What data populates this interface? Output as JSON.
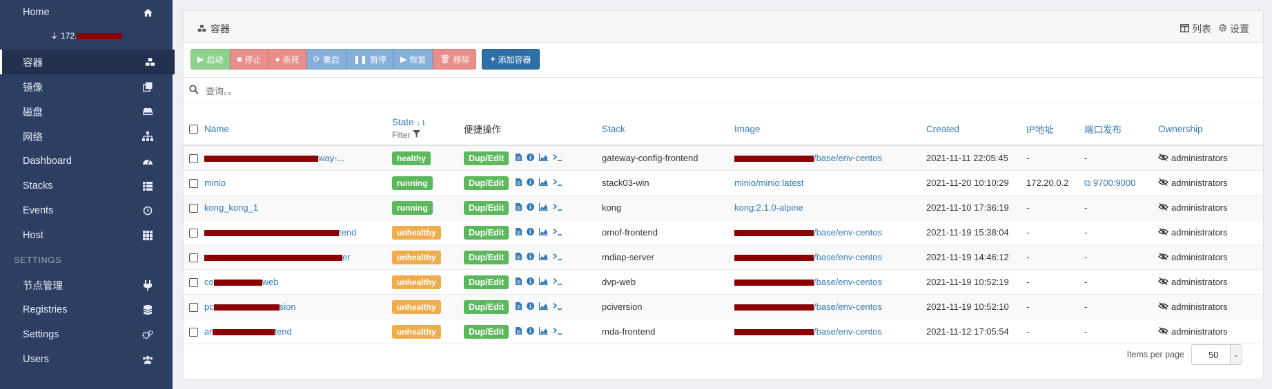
{
  "sidebar": {
    "items": [
      {
        "label": "Home",
        "icon": "home-icon"
      },
      {
        "label": "容器",
        "icon": "cubes-icon",
        "active": true
      },
      {
        "label": "镜像",
        "icon": "clone-icon"
      },
      {
        "label": "磁盘",
        "icon": "hdd-icon"
      },
      {
        "label": "网络",
        "icon": "sitemap-icon"
      },
      {
        "label": "Dashboard",
        "icon": "tachometer-icon"
      },
      {
        "label": "Stacks",
        "icon": "th-list-icon"
      },
      {
        "label": "Events",
        "icon": "history-icon"
      },
      {
        "label": "Host",
        "icon": "th-icon"
      }
    ],
    "host_prefix": "172.",
    "settings_header": "SETTINGS",
    "settings_items": [
      {
        "label": "节点管理",
        "icon": "plug-icon"
      },
      {
        "label": "Registries",
        "icon": "database-icon"
      },
      {
        "label": "Settings",
        "icon": "cogs-icon"
      },
      {
        "label": "Users",
        "icon": "users-icon"
      }
    ]
  },
  "panel": {
    "title": "容器",
    "list_label": "列表",
    "settings_label": "设置"
  },
  "toolbar": {
    "start": "启动",
    "stop": "停止",
    "kill": "杀死",
    "restart": "重启",
    "pause": "暂停",
    "resume": "恢复",
    "remove": "移除",
    "add": "添加容器"
  },
  "search": {
    "placeholder": "查询。。"
  },
  "table": {
    "headers": {
      "name": "Name",
      "state": "State",
      "filter": "Filter",
      "quick": "便捷操作",
      "stack": "Stack",
      "image": "Image",
      "created": "Created",
      "ip": "IP地址",
      "ports": "端口发布",
      "ownership": "Ownership"
    },
    "rows": [
      {
        "name_visible": "way-...",
        "state": "healthy",
        "stack": "gateway-config-frontend",
        "image_visible": "/base/env-centos",
        "created": "2021-11-11 22:05:45",
        "ip": "-",
        "ports": "-",
        "ownership": "administrators"
      },
      {
        "name_visible": "minio",
        "state": "running",
        "stack": "stack03-win",
        "image_visible": "minio/minio:latest",
        "created": "2021-11-20 10:10:29",
        "ip": "172.20.0.2",
        "ports": "9700:9000",
        "ownership": "administrators"
      },
      {
        "name_visible": "kong_kong_1",
        "state": "running",
        "stack": "kong",
        "image_visible": "kong:2.1.0-alpine",
        "created": "2021-11-10 17:36:19",
        "ip": "-",
        "ports": "-",
        "ownership": "administrators"
      },
      {
        "name_visible": "tend",
        "state": "unhealthy",
        "stack": "omof-frontend",
        "image_visible": "/base/env-centos",
        "created": "2021-11-19 15:38:04",
        "ip": "-",
        "ports": "-",
        "ownership": "administrators"
      },
      {
        "name_visible": "er",
        "state": "unhealthy",
        "stack": "mdiap-server",
        "image_visible": "/base/env-centos",
        "created": "2021-11-19 14:46:12",
        "ip": "-",
        "ports": "-",
        "ownership": "administrators"
      },
      {
        "name_visible": "web",
        "state": "unhealthy",
        "stack": "dvp-web",
        "image_visible": "/base/env-centos",
        "created": "2021-11-19 10:52:19",
        "ip": "-",
        "ports": "-",
        "ownership": "administrators"
      },
      {
        "name_visible": "sion",
        "state": "unhealthy",
        "stack": "pciversion",
        "image_visible": "/base/env-centos",
        "created": "2021-11-19 10:52:10",
        "ip": "-",
        "ports": "-",
        "ownership": "administrators"
      },
      {
        "name_visible": "tend",
        "state": "unhealthy",
        "stack": "mda-frontend",
        "image_visible": "/base/env-centos",
        "created": "2021-11-12 17:05:54",
        "ip": "-",
        "ports": "-",
        "ownership": "administrators"
      }
    ],
    "dup_label": "Dup/Edit",
    "name_prefixes": [
      "",
      "",
      "",
      "",
      "",
      "co",
      "pc",
      "ar"
    ]
  },
  "footer": {
    "items_per_page_label": "Items per page",
    "items_per_page": "50"
  }
}
